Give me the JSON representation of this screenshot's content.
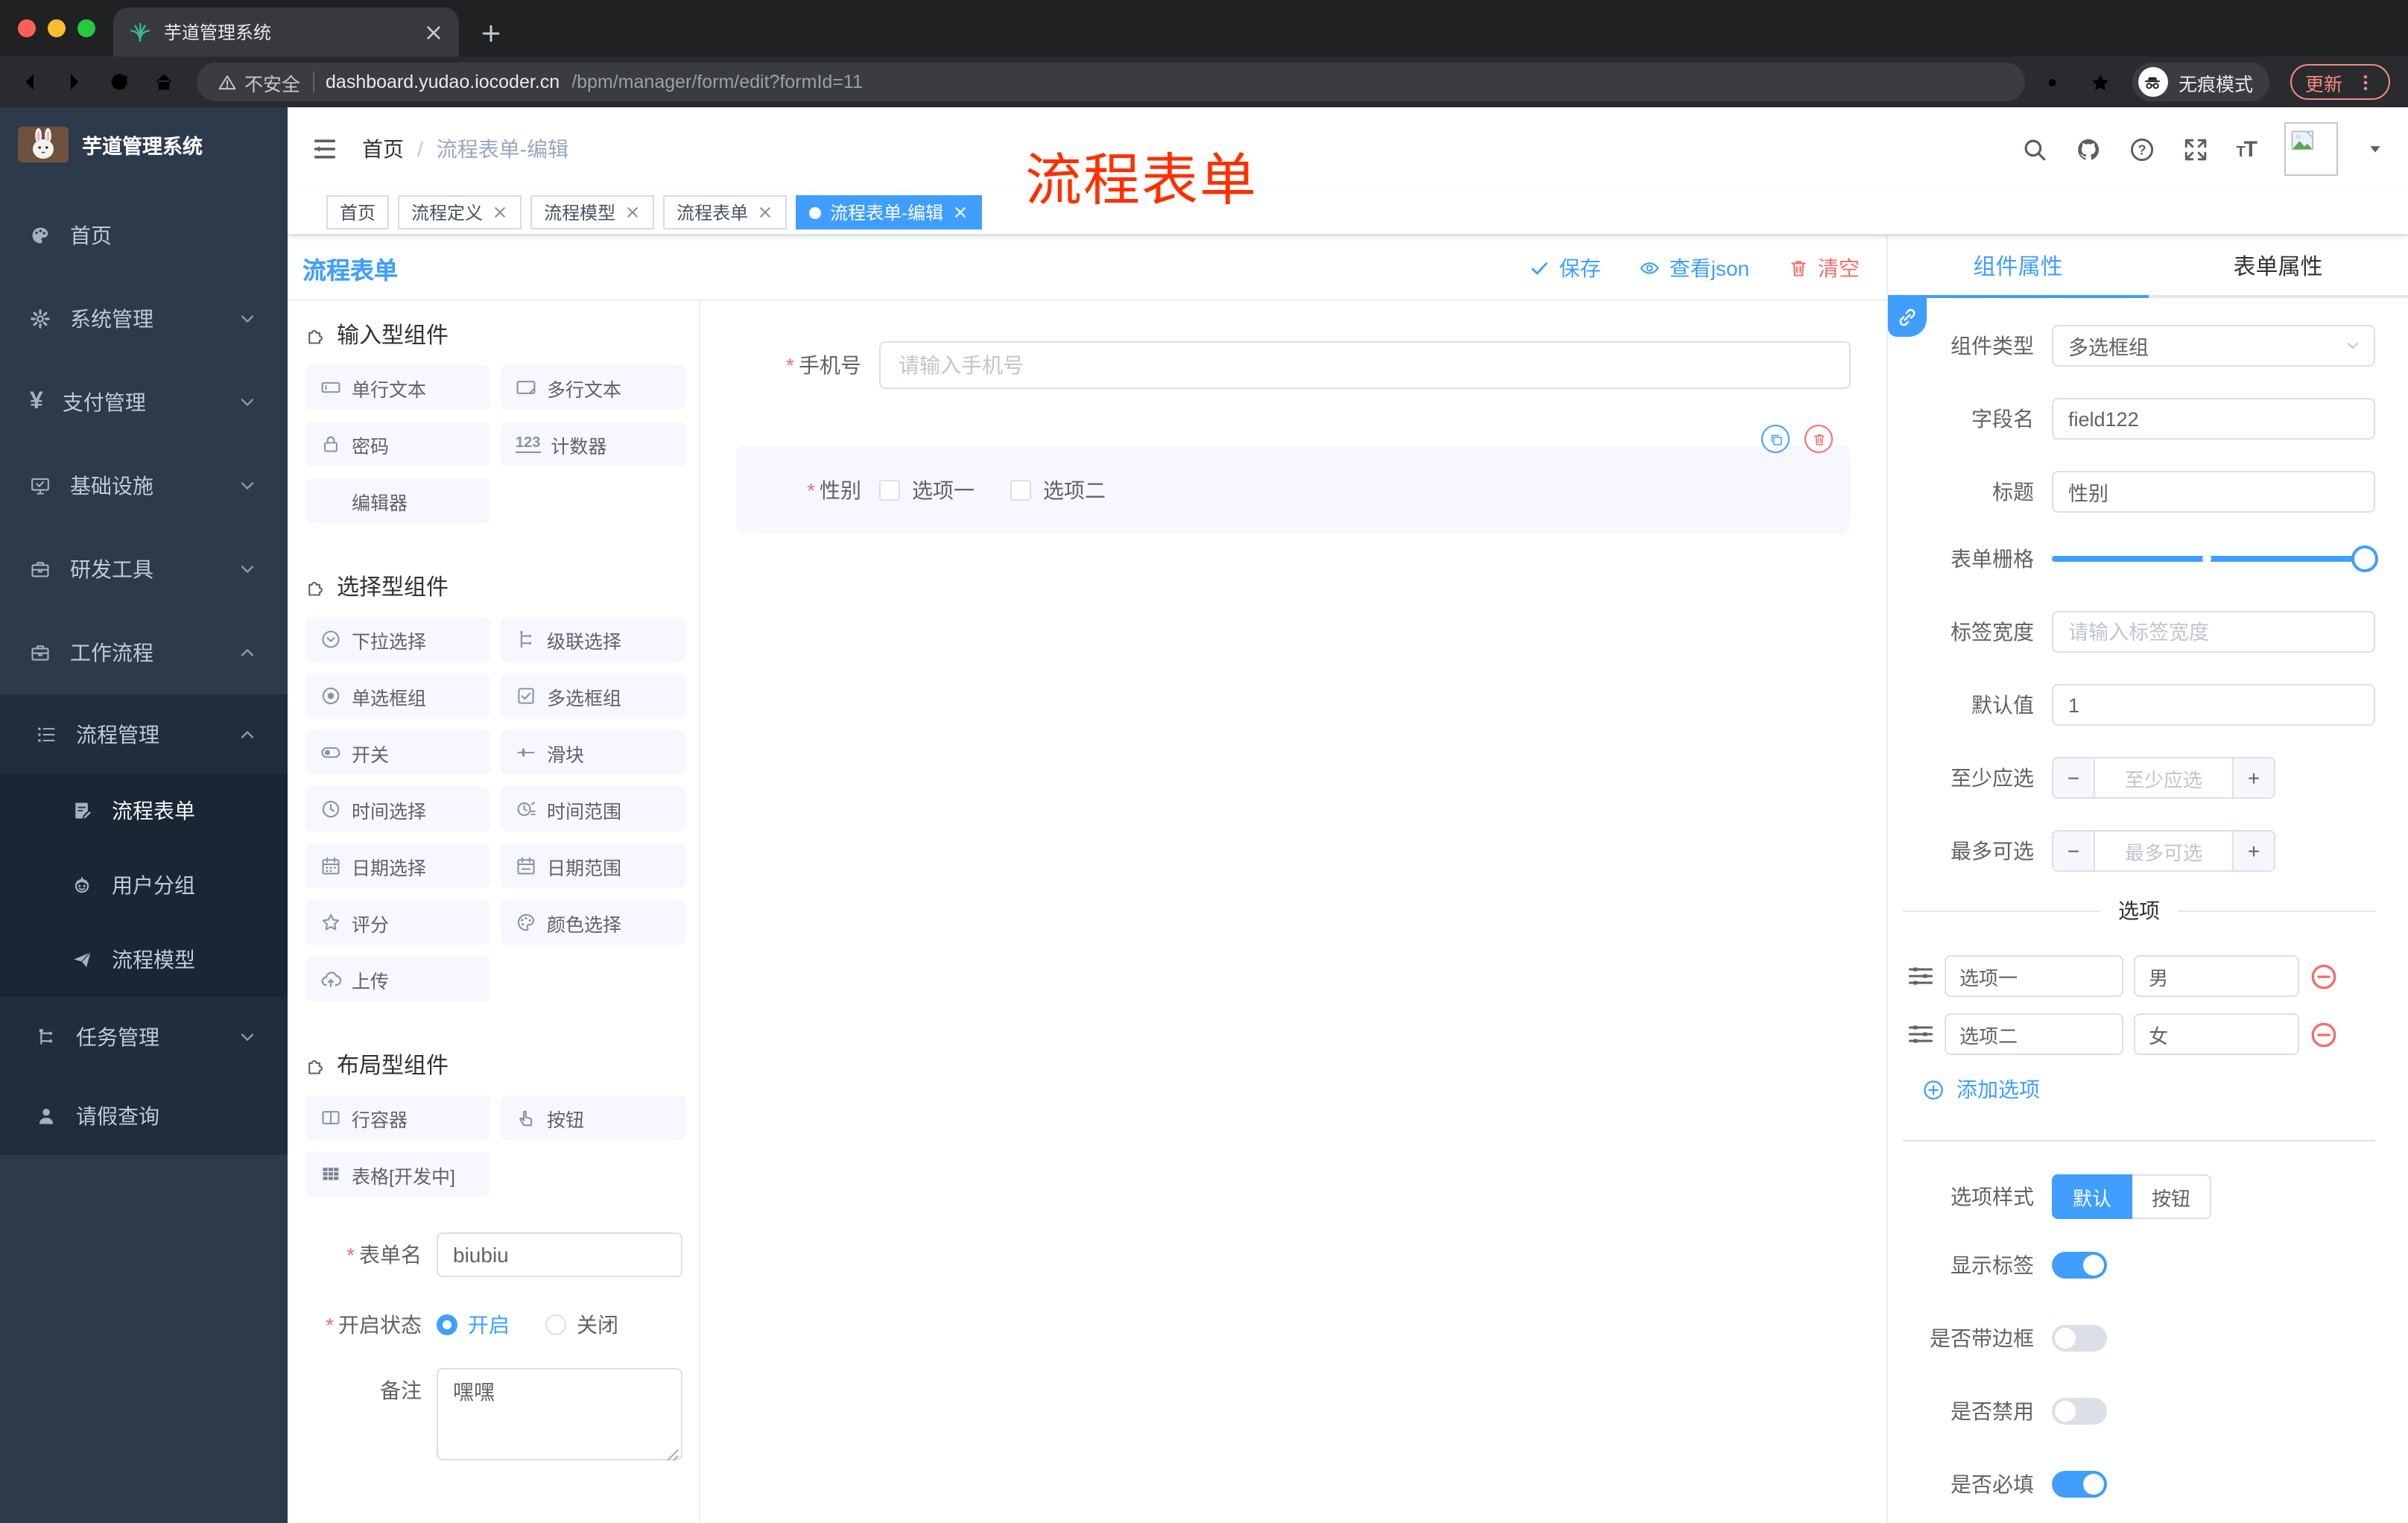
{
  "browser": {
    "tab_title": "芋道管理系统",
    "security": "不安全",
    "url_host": "dashboard.yudao.iocoder.cn",
    "url_path": "/bpm/manager/form/edit?formId=11",
    "incognito": "无痕模式",
    "update": "更新"
  },
  "annotation": "流程表单",
  "sidebar": {
    "title": "芋道管理系统",
    "items": [
      {
        "label": "首页"
      },
      {
        "label": "系统管理"
      },
      {
        "label": "支付管理"
      },
      {
        "label": "基础设施"
      },
      {
        "label": "研发工具"
      },
      {
        "label": "工作流程"
      }
    ],
    "workflow": {
      "process_mgmt": "流程管理",
      "children": [
        {
          "label": "流程表单"
        },
        {
          "label": "用户分组"
        },
        {
          "label": "流程模型"
        }
      ],
      "task_mgmt": "任务管理",
      "leave_query": "请假查询"
    }
  },
  "navbar": {
    "breadcrumb_home": "首页",
    "breadcrumb_current": "流程表单-编辑"
  },
  "tags": [
    {
      "label": "首页"
    },
    {
      "label": "流程定义"
    },
    {
      "label": "流程模型"
    },
    {
      "label": "流程表单"
    },
    {
      "label": "流程表单-编辑"
    }
  ],
  "editor": {
    "title": "流程表单",
    "save": "保存",
    "view_json": "查看json",
    "clear": "清空"
  },
  "components": {
    "input_group": {
      "title": "输入型组件",
      "items": [
        "单行文本",
        "多行文本",
        "密码",
        "计数器",
        "编辑器"
      ]
    },
    "select_group": {
      "title": "选择型组件",
      "items": [
        "下拉选择",
        "级联选择",
        "单选框组",
        "多选框组",
        "开关",
        "滑块",
        "时间选择",
        "时间范围",
        "日期选择",
        "日期范围",
        "评分",
        "颜色选择",
        "上传"
      ]
    },
    "layout_group": {
      "title": "布局型组件",
      "items": [
        "行容器",
        "按钮",
        "表格[开发中]"
      ]
    }
  },
  "form_settings": {
    "name_label": "表单名",
    "name_value": "biubiu",
    "status_label": "开启状态",
    "status_on": "开启",
    "status_off": "关闭",
    "remark_label": "备注",
    "remark_value": "嘿嘿"
  },
  "canvas": {
    "phone": {
      "label": "手机号",
      "placeholder": "请输入手机号"
    },
    "gender": {
      "label": "性别",
      "options": [
        "选项一",
        "选项二"
      ]
    }
  },
  "panel": {
    "tab_component": "组件属性",
    "tab_form": "表单属性",
    "rows": {
      "type_label": "组件类型",
      "type_value": "多选框组",
      "field_label": "字段名",
      "field_value": "field122",
      "title_label": "标题",
      "title_value": "性别",
      "grid_label": "表单栅格",
      "width_label": "标签宽度",
      "width_placeholder": "请输入标签宽度",
      "default_label": "默认值",
      "default_value": "1",
      "min_label": "至少应选",
      "min_placeholder": "至少应选",
      "max_label": "最多可选",
      "max_placeholder": "最多可选"
    },
    "options": {
      "divider": "选项",
      "rows": [
        {
          "label": "选项一",
          "value": "男"
        },
        {
          "label": "选项二",
          "value": "女"
        }
      ],
      "add": "添加选项",
      "style_label": "选项样式",
      "style_default": "默认",
      "style_button": "按钮",
      "show_label": "显示标签",
      "border_label": "是否带边框",
      "disabled_label": "是否禁用",
      "required_label": "是否必填"
    }
  },
  "colors": {
    "accent": "#409eff",
    "danger": "#f56c6c",
    "annotation": "#ff3000"
  }
}
